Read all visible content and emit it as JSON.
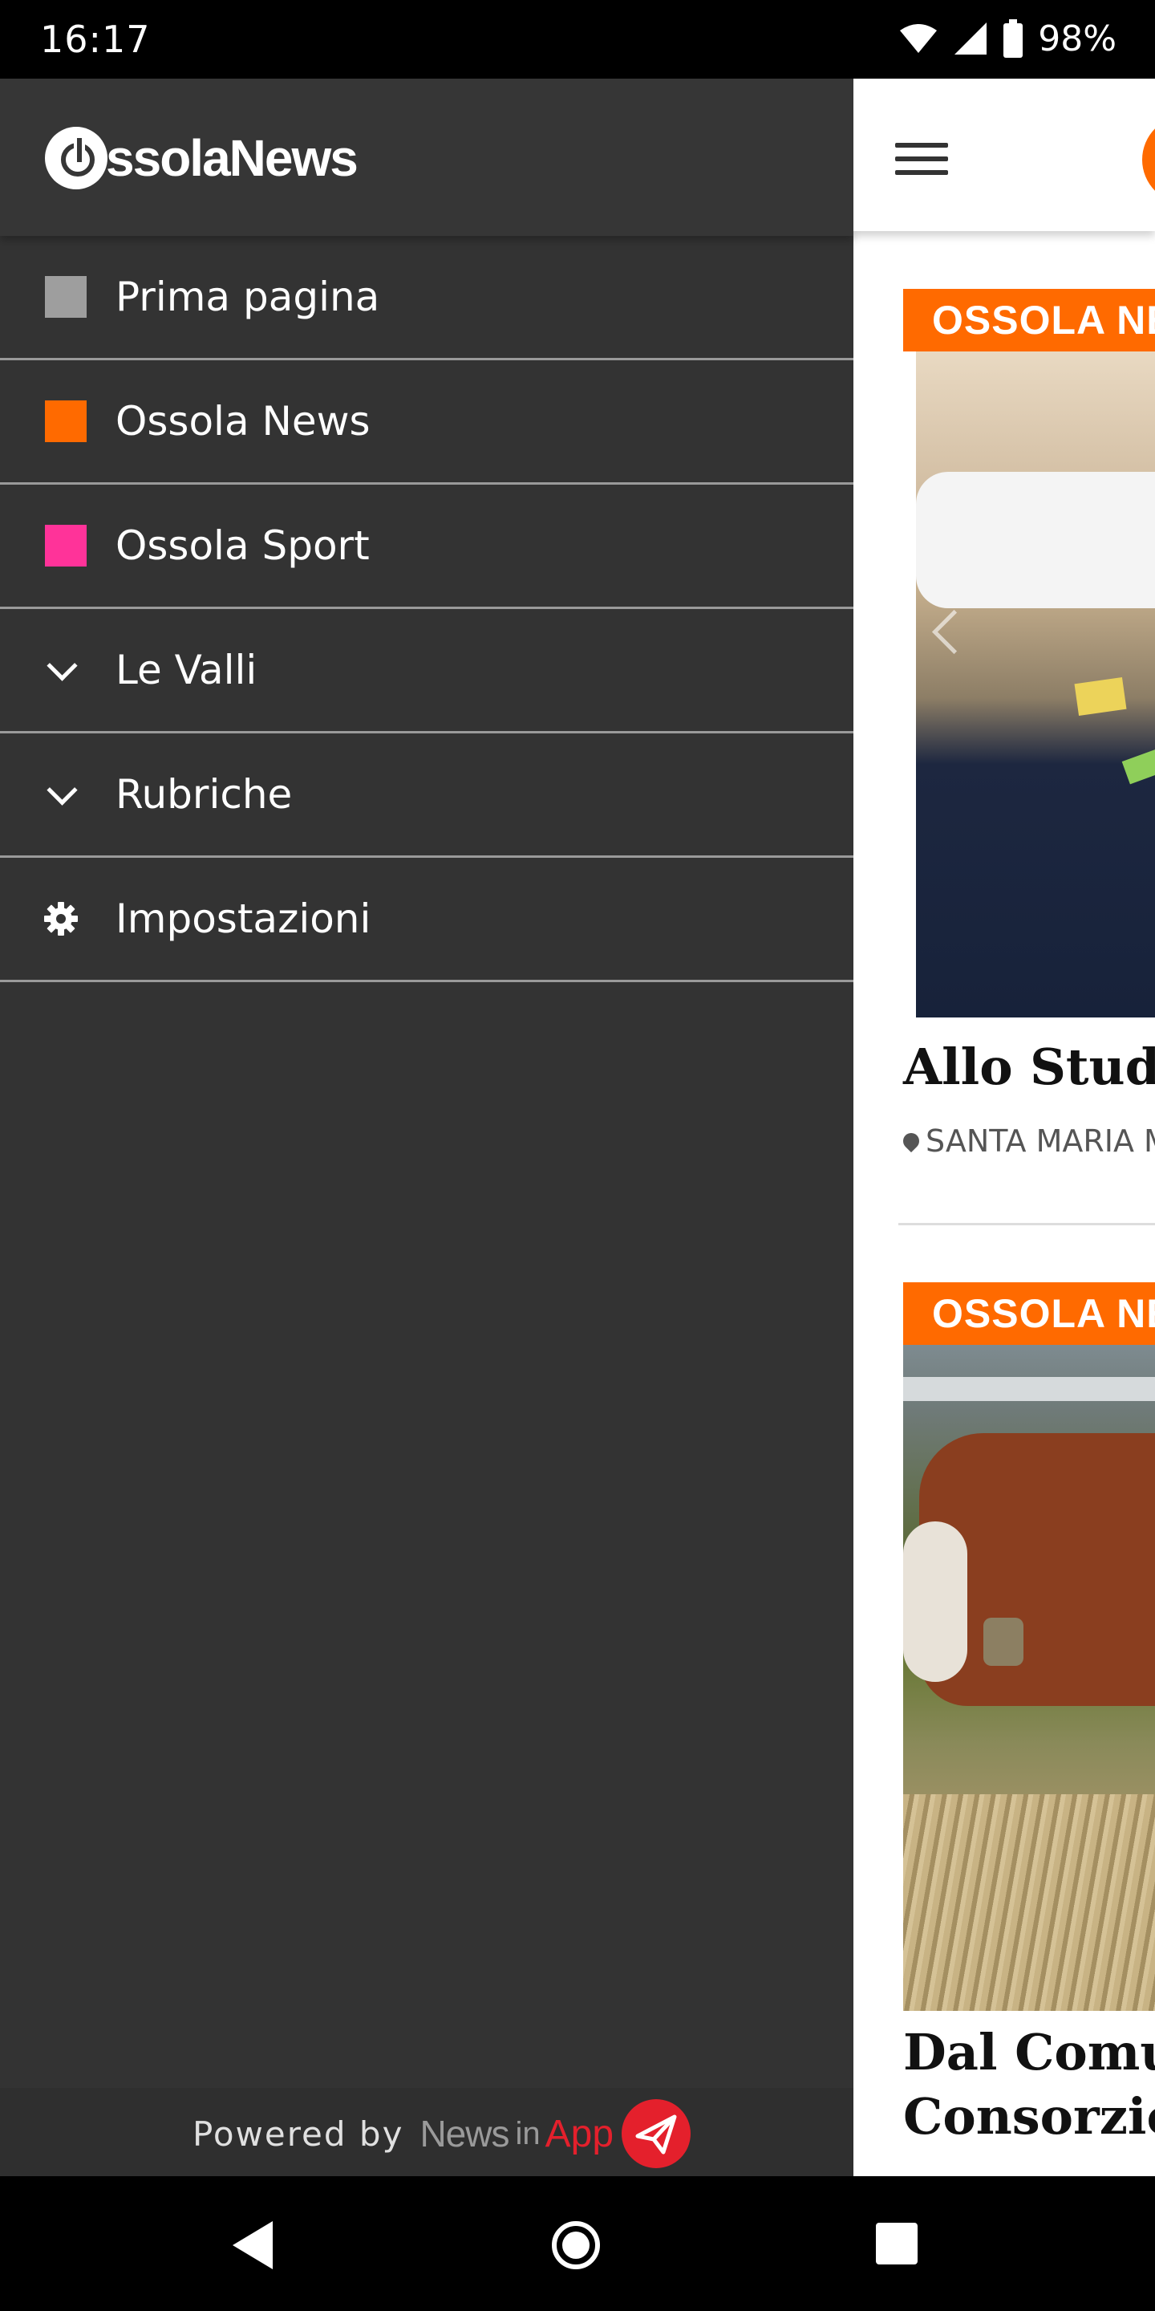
{
  "status_bar": {
    "time": "16:17",
    "battery": "98%"
  },
  "drawer": {
    "logo_text": "ssolaNews",
    "menu_items": [
      {
        "label": "Prima pagina",
        "icon": "square",
        "color": "#9e9e9e"
      },
      {
        "label": "Ossola News",
        "icon": "square",
        "color": "#ff6a00"
      },
      {
        "label": "Ossola Sport",
        "icon": "square",
        "color": "#ff3399"
      },
      {
        "label": "Le Valli",
        "icon": "chevron-down-icon"
      },
      {
        "label": "Rubriche",
        "icon": "chevron-down-icon"
      },
      {
        "label": "Impostazioni",
        "icon": "gear-icon"
      }
    ],
    "footer": {
      "powered_by": "Powered by",
      "brand_news": "News",
      "brand_in": "in",
      "brand_app": "App"
    }
  },
  "feed": {
    "cards": [
      {
        "tag": "OSSOLA NE",
        "headline": "Allo Studio",
        "location": "SANTA MARIA M"
      },
      {
        "tag": "OSSOLA NE",
        "headline_line1": "Dal Comun",
        "headline_line2": "Consorzio"
      }
    ]
  },
  "colors": {
    "accent_orange": "#ff6a00",
    "drawer_bg": "#333333",
    "brand_red": "#e4202c"
  }
}
